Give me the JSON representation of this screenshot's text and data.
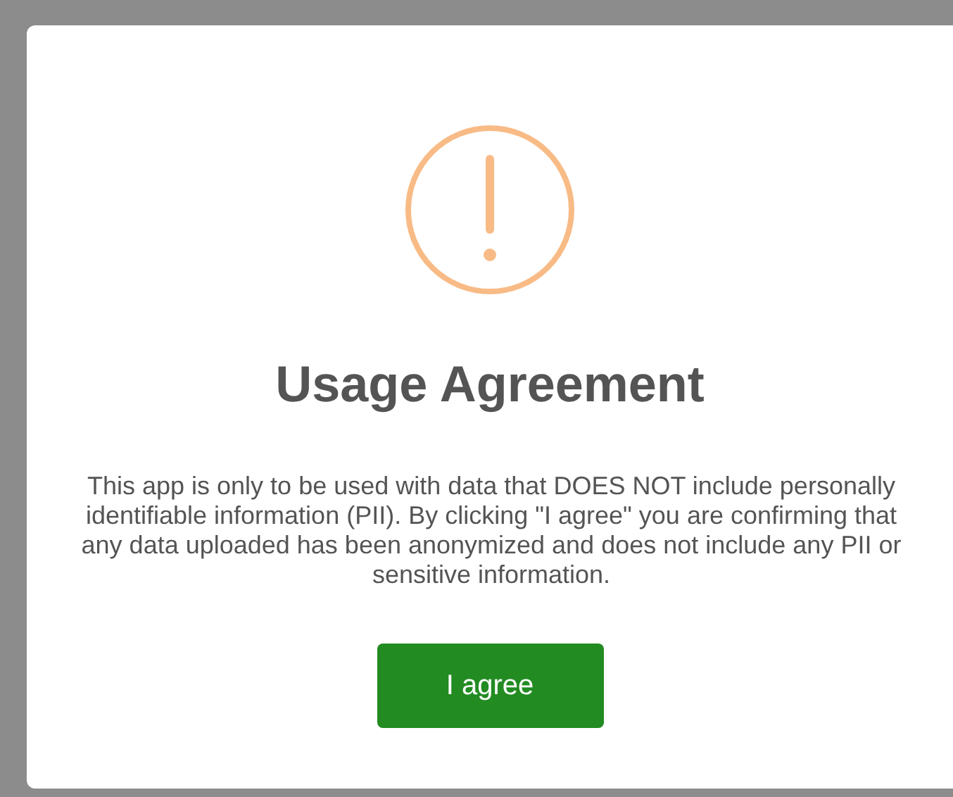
{
  "dialog": {
    "title": "Usage Agreement",
    "message": "This app is only to be used with data that DOES NOT include personally identifiable information (PII). By clicking \"I agree\" you are confirming that any data uploaded has been anonymized and does not include any PII or sensitive information.",
    "button": "I agree"
  }
}
